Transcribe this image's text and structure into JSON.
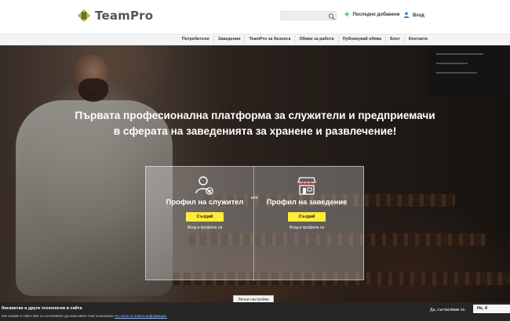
{
  "header": {
    "logo_text": "TeamPro",
    "search_placeholder": "",
    "recent_label": "Последно добавени",
    "login_label": "Вход"
  },
  "nav": {
    "items": [
      {
        "label": "Потребители"
      },
      {
        "label": "Заведения"
      },
      {
        "label": "TeamPro за бизнеса"
      },
      {
        "label": "Обяви за работа"
      },
      {
        "label": "Публикувай обява"
      },
      {
        "label": "Блог"
      },
      {
        "label": "Контакти"
      }
    ]
  },
  "hero": {
    "title": "Първата професионална платформа за служители и предприемачи в сферата на заведенията за хранене и развлечение!"
  },
  "signup": {
    "or_label": "или",
    "employee": {
      "title": "Профил на служител",
      "create_label": "Създай",
      "login_link": "Вход в профила си"
    },
    "venue": {
      "title": "Профил на заведение",
      "create_label": "Създай",
      "login_link": "Вход в профила си"
    }
  },
  "cookie": {
    "title": "бисквитки и други технологии в сайта",
    "text": "ние искаме и сайте Вие се съгласявате да използвате тези технологии.",
    "link_text": "Не, моля за повече информация.",
    "personal_settings": "Лични настройки",
    "agree_label": "Да, съгласявам се.",
    "decline_label": "Не, б"
  },
  "colors": {
    "accent_yellow": "#ffeb3b",
    "green_plus": "#3fb24f",
    "user_blue": "#2d7fd3"
  },
  "icons": {
    "search": "search-icon",
    "plus": "plus-icon",
    "user": "user-icon",
    "employee": "user-check-icon",
    "venue": "storefront-icon"
  }
}
